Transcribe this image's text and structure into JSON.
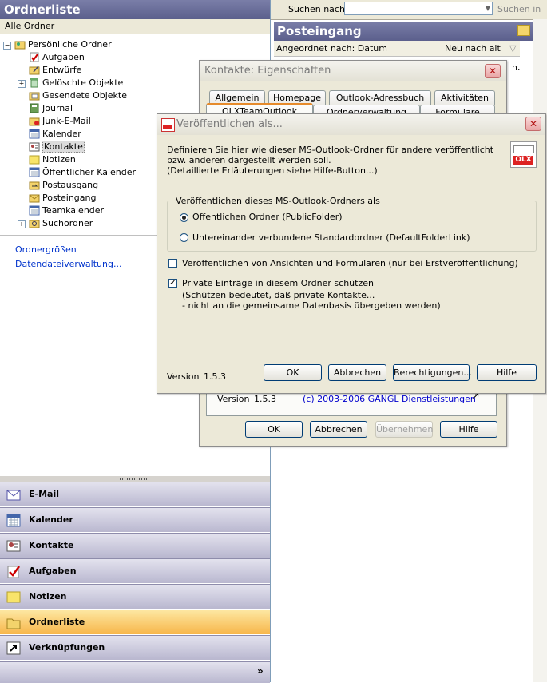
{
  "left": {
    "header": "Ordnerliste",
    "all_folders": "Alle Ordner",
    "tree": [
      {
        "label": "Persönliche Ordner",
        "icon": "personal-folders-icon"
      },
      {
        "label": "Aufgaben",
        "icon": "tasks-icon"
      },
      {
        "label": "Entwürfe",
        "icon": "drafts-icon"
      },
      {
        "label": "Gelöschte Objekte",
        "icon": "deleted-items-icon"
      },
      {
        "label": "Gesendete Objekte",
        "icon": "sent-items-icon"
      },
      {
        "label": "Journal",
        "icon": "journal-icon"
      },
      {
        "label": "Junk-E-Mail",
        "icon": "junk-mail-icon"
      },
      {
        "label": "Kalender",
        "icon": "calendar-icon"
      },
      {
        "label": "Kontakte",
        "icon": "contacts-icon"
      },
      {
        "label": "Notizen",
        "icon": "notes-icon"
      },
      {
        "label": "Öffentlicher Kalender",
        "icon": "calendar-icon"
      },
      {
        "label": "Postausgang",
        "icon": "outbox-icon"
      },
      {
        "label": "Posteingang",
        "icon": "inbox-icon"
      },
      {
        "label": "Teamkalender",
        "icon": "calendar-icon"
      },
      {
        "label": "Suchordner",
        "icon": "search-folder-icon"
      }
    ],
    "links": [
      "Ordnergrößen",
      "Datendateiverwaltung..."
    ],
    "nav": [
      {
        "label": "E-Mail",
        "icon": "mail-icon"
      },
      {
        "label": "Kalender",
        "icon": "calendar-icon"
      },
      {
        "label": "Kontakte",
        "icon": "contacts-icon"
      },
      {
        "label": "Aufgaben",
        "icon": "tasks-icon"
      },
      {
        "label": "Notizen",
        "icon": "notes-icon"
      },
      {
        "label": "Ordnerliste",
        "icon": "folder-list-icon"
      },
      {
        "label": "Verknüpfungen",
        "icon": "shortcut-icon"
      }
    ],
    "nav_more": "»"
  },
  "right": {
    "search_label": "Suchen nach:",
    "search_in": "Suchen in",
    "inbox_title": "Posteingang",
    "sort_by": "Angeordnet nach: Datum",
    "sort_order": "Neu nach alt",
    "peek_text": "n."
  },
  "contacts_dialog": {
    "title": "Kontakte: Eigenschaften",
    "tabs_row1": [
      "Allgemein",
      "Homepage",
      "Outlook-Adressbuch",
      "Aktivitäten"
    ],
    "tabs_row2": [
      "OLXTeamOutlook",
      "Ordnerverwaltung",
      "Formulare"
    ],
    "version_label": "Version",
    "version": "1.5.3",
    "copyright": "(c) 2003-2006 GANGL Dienstleistungen",
    "buttons": {
      "ok": "OK",
      "cancel": "Abbrechen",
      "apply": "Übernehmen",
      "help": "Hilfe"
    }
  },
  "publish_dialog": {
    "title": "Veröffentlichen als...",
    "desc": [
      "Definieren Sie hier wie dieser MS-Outlook-Ordner für andere veröffentlicht",
      "bzw. anderen dargestellt werden soll.",
      "(Detaillierte Erläuterungen siehe Hilfe-Button...)"
    ],
    "group_label": "Veröffentlichen dieses MS-Outlook-Ordners als",
    "option1": "Öffentlichen Ordner (PublicFolder)",
    "option2": "Untereinander verbundene Standardordner (DefaultFolderLink)",
    "check1": "Veröffentlichen von Ansichten und Formularen (nur bei Erstveröffentlichung)",
    "check2": "Private Einträge in diesem Ordner schützen",
    "check2_note": [
      "(Schützen bedeutet, daß private Kontakte...",
      "- nicht an die gemeinsame Datenbasis übergeben werden)"
    ],
    "version_label": "Version",
    "version": "1.5.3",
    "buttons": {
      "ok": "OK",
      "cancel": "Abbrechen",
      "permissions": "Berechtigungen...",
      "help": "Hilfe"
    },
    "logo_text": "OLX"
  }
}
